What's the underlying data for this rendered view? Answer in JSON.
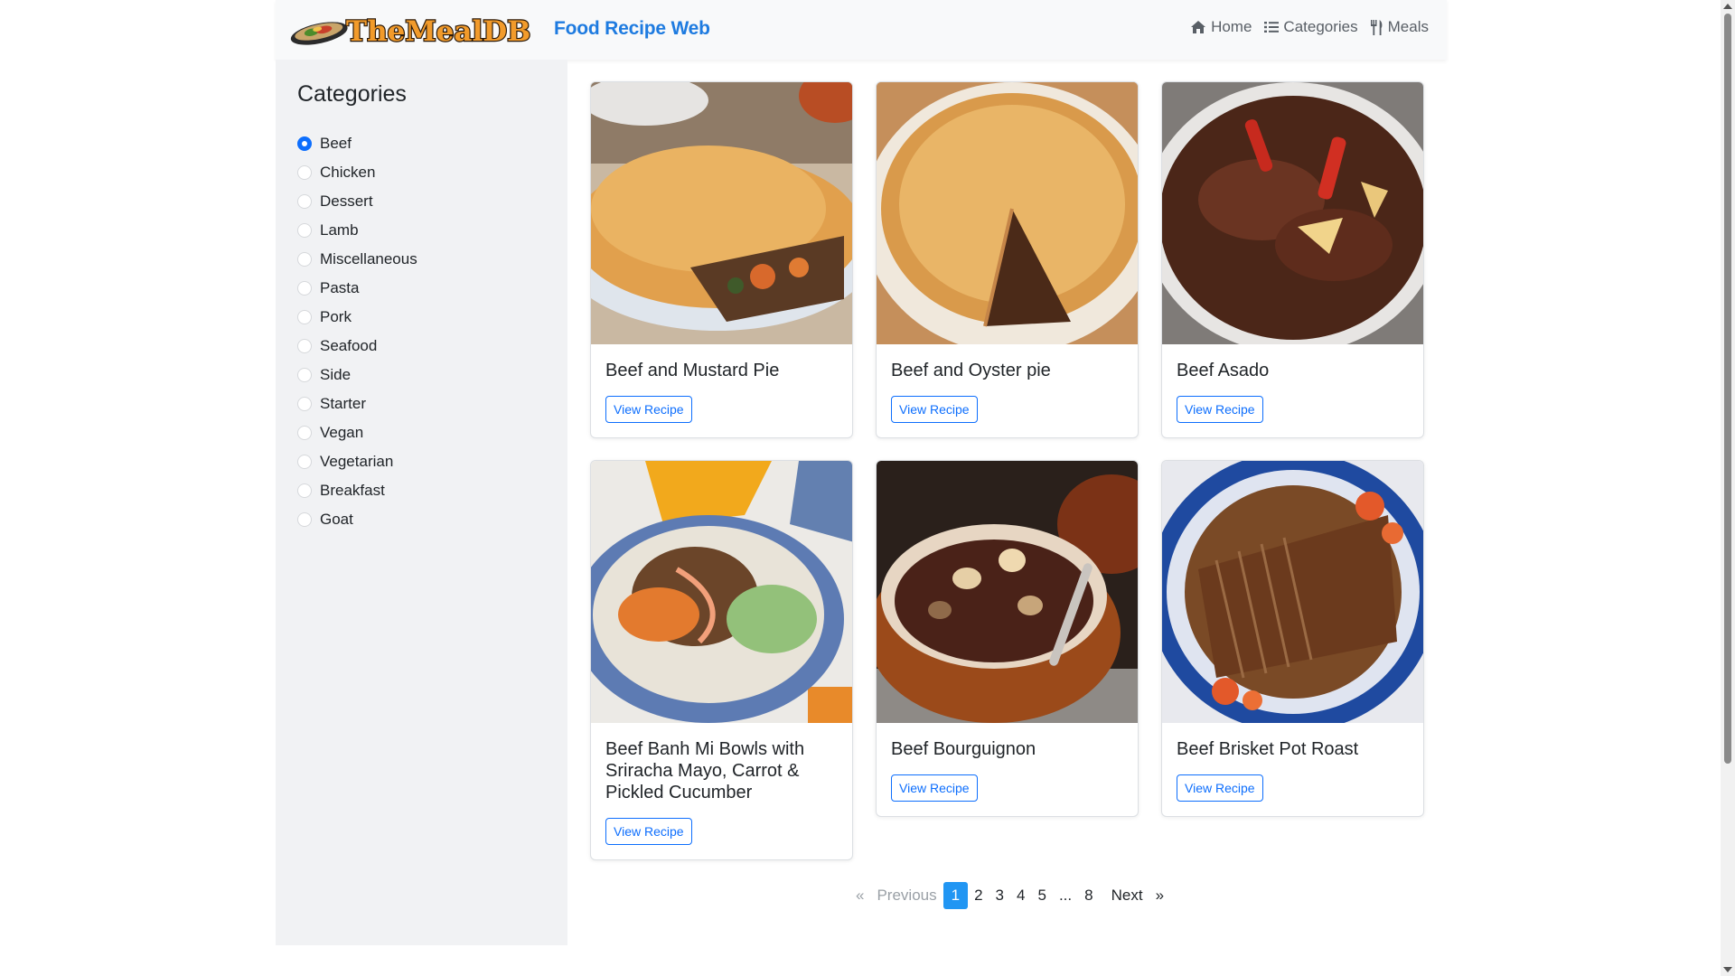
{
  "header": {
    "logo_text": "TheMealDB",
    "brand": "Food Recipe Web",
    "nav": [
      {
        "label": "Home",
        "icon": "home-icon"
      },
      {
        "label": "Categories",
        "icon": "list-icon"
      },
      {
        "label": "Meals",
        "icon": "utensils-icon"
      }
    ]
  },
  "sidebar": {
    "title": "Categories",
    "selected": "Beef",
    "items": [
      {
        "label": "Beef"
      },
      {
        "label": "Chicken"
      },
      {
        "label": "Dessert"
      },
      {
        "label": "Lamb"
      },
      {
        "label": "Miscellaneous"
      },
      {
        "label": "Pasta"
      },
      {
        "label": "Pork"
      },
      {
        "label": "Seafood"
      },
      {
        "label": "Side"
      },
      {
        "label": "Starter"
      },
      {
        "label": "Vegan"
      },
      {
        "label": "Vegetarian"
      },
      {
        "label": "Breakfast"
      },
      {
        "label": "Goat"
      }
    ]
  },
  "meals": [
    {
      "title": "Beef and Mustard Pie",
      "button": "View Recipe"
    },
    {
      "title": "Beef and Oyster pie",
      "button": "View Recipe"
    },
    {
      "title": "Beef Asado",
      "button": "View Recipe"
    },
    {
      "title": "Beef Banh Mi Bowls with Sriracha Mayo, Carrot & Pickled Cucumber",
      "button": "View Recipe"
    },
    {
      "title": "Beef Bourguignon",
      "button": "View Recipe"
    },
    {
      "title": "Beef Brisket Pot Roast",
      "button": "View Recipe"
    }
  ],
  "pagination": {
    "prev_symbol": "«",
    "prev_label": "Previous",
    "pages": [
      "1",
      "2",
      "3",
      "4",
      "5",
      "...",
      "8"
    ],
    "active_page": "1",
    "next_label": "Next",
    "next_symbol": "»"
  },
  "colors": {
    "brand": "#1e7be0",
    "primary": "#0d6efd",
    "active_page": "#2196f3",
    "sidebar_bg": "#f1f2f4",
    "navbar_bg": "#f8f9fa"
  }
}
